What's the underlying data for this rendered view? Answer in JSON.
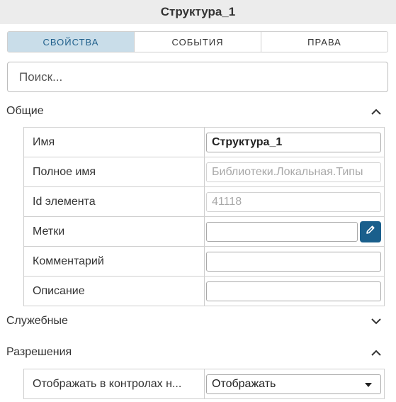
{
  "header": {
    "title": "Структура_1"
  },
  "tabs": [
    {
      "label": "СВОЙСТВА",
      "active": true
    },
    {
      "label": "СОБЫТИЯ",
      "active": false
    },
    {
      "label": "ПРАВА",
      "active": false
    }
  ],
  "search": {
    "placeholder": "Поиск..."
  },
  "sections": {
    "general": {
      "title": "Общие",
      "expanded": true,
      "rows": [
        {
          "label": "Имя",
          "value": "Структура_1"
        },
        {
          "label": "Полное имя",
          "value": "Библиотеки.Локальная.Типы"
        },
        {
          "label": "Id элемента",
          "value": "41118"
        },
        {
          "label": "Метки",
          "value": ""
        },
        {
          "label": "Комментарий",
          "value": ""
        },
        {
          "label": "Описание",
          "value": ""
        }
      ]
    },
    "service": {
      "title": "Служебные",
      "expanded": false
    },
    "permissions": {
      "title": "Разрешения",
      "expanded": true,
      "rows": [
        {
          "label": "Отображать в контролах н...",
          "value": "Отображать"
        }
      ]
    }
  },
  "colors": {
    "accent": "#1a5f8c",
    "tab_active_bg": "#c9dde9",
    "header_bg": "#ececec"
  }
}
